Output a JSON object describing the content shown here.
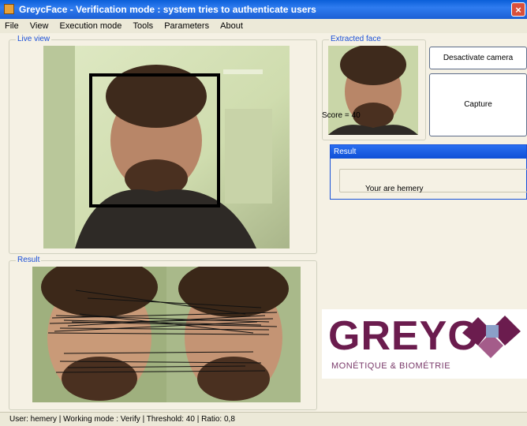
{
  "window": {
    "title": "GreycFace - Verification mode : system tries to authenticate users",
    "close_glyph": "×"
  },
  "menu": [
    "File",
    "View",
    "Execution mode",
    "Tools",
    "Parameters",
    "About"
  ],
  "panels": {
    "live_view": "Live view",
    "result": "Result",
    "extracted_face": "Extracted face"
  },
  "buttons": {
    "deactivate": "Desactivate camera",
    "capture": "Capture"
  },
  "score": "Score = 40",
  "result_dialog": {
    "title": "Result",
    "message": "Your are hemery"
  },
  "logo": {
    "word": "GREYC",
    "tagline": "MONÉTIQUE & BIOMÉTRIE"
  },
  "status": "User: hemery  | Working mode : Verify  | Threshold: 40  | Ratio: 0,8",
  "colors": {
    "titlebar": "#0a5fd8",
    "face_box": "#000000",
    "logo": "#6b1c4e",
    "accent_blue": "#1a4fd8"
  }
}
